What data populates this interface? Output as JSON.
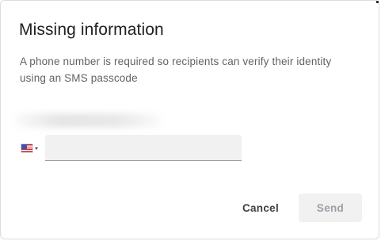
{
  "dialog": {
    "title": "Missing information",
    "description": "A phone number is required so recipients can verify their identity using an SMS passcode"
  },
  "phone": {
    "country_flag_icon": "us-flag-icon",
    "dropdown_icon": "caret-down-icon",
    "value": "",
    "placeholder": ""
  },
  "actions": {
    "cancel_label": "Cancel",
    "send_label": "Send"
  },
  "colors": {
    "title": "#202124",
    "description": "#5f6368",
    "input_background": "#f1f1f1",
    "send_disabled_background": "#f1f1f1",
    "send_disabled_text": "#9aa0a6"
  }
}
